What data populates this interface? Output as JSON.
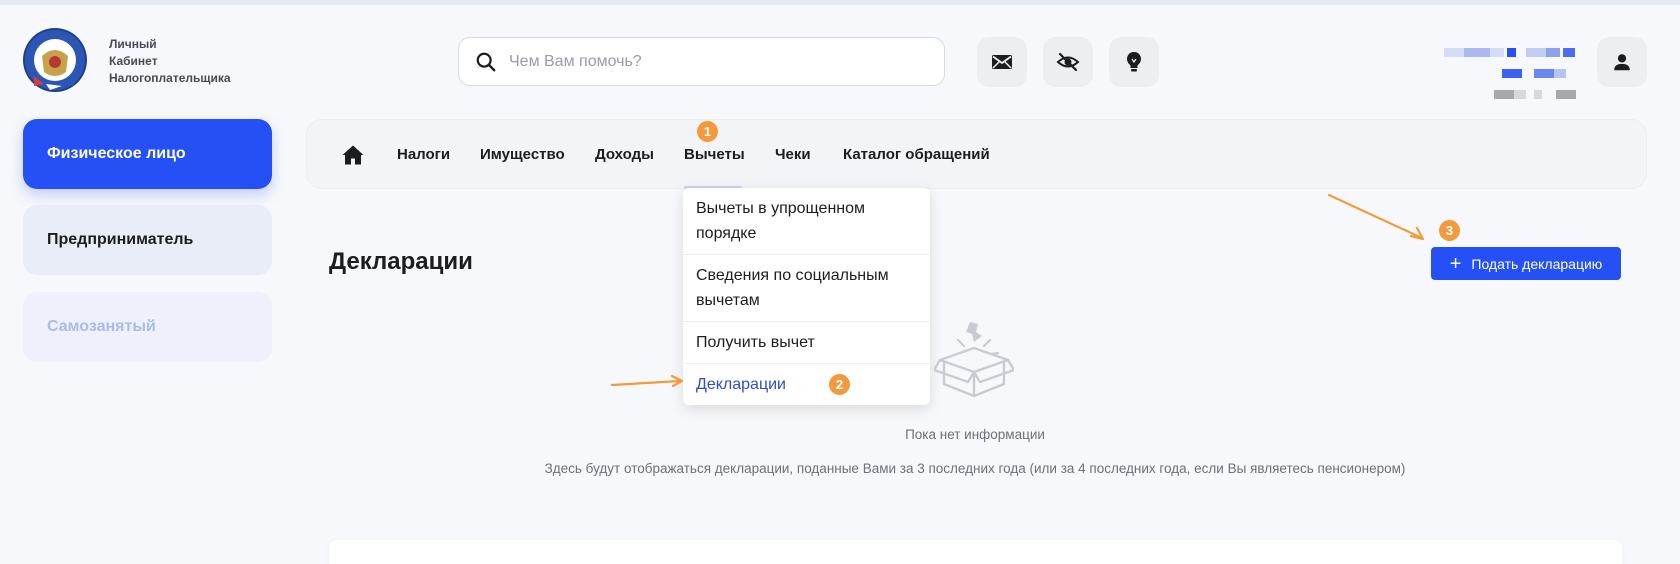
{
  "brand": {
    "line1": "Личный",
    "line2": "Кабинет",
    "line3": "Налогоплательщика"
  },
  "search": {
    "placeholder": "Чем Вам помочь?",
    "icon": "search-icon"
  },
  "header_icons": [
    "mail-icon",
    "eye-off-icon",
    "lightbulb-icon",
    "user-icon"
  ],
  "roles": {
    "individual": "Физическое лицо",
    "entrepreneur": "Предприниматель",
    "self_employed": "Самозанятый"
  },
  "nav": {
    "home_icon": "home-icon",
    "items": [
      "Налоги",
      "Имущество",
      "Доходы",
      "Вычеты",
      "Чеки",
      "Каталог обращений"
    ]
  },
  "dropdown": {
    "items": [
      {
        "line1": "Вычеты в упрощенном",
        "line2": "порядке"
      },
      {
        "line1": "Сведения по социальным",
        "line2": "вычетам"
      },
      {
        "line1": "Получить вычет"
      },
      {
        "line1": "Декларации"
      }
    ]
  },
  "annotations": {
    "step1": "1",
    "step2": "2",
    "step3": "3",
    "accent": "#f29a3c"
  },
  "main": {
    "title": "Декларации",
    "submit_button": "Подать декларацию",
    "empty_title": "Пока нет информации",
    "empty_description": "Здесь будут отображаться декларации, поданные Вами за 3 последних года (или за 4 последних года, если Вы являетесь пенсионером)"
  },
  "colors": {
    "primary": "#2450f5",
    "link": "#2d4fc7",
    "background": "#f7f8fb"
  }
}
